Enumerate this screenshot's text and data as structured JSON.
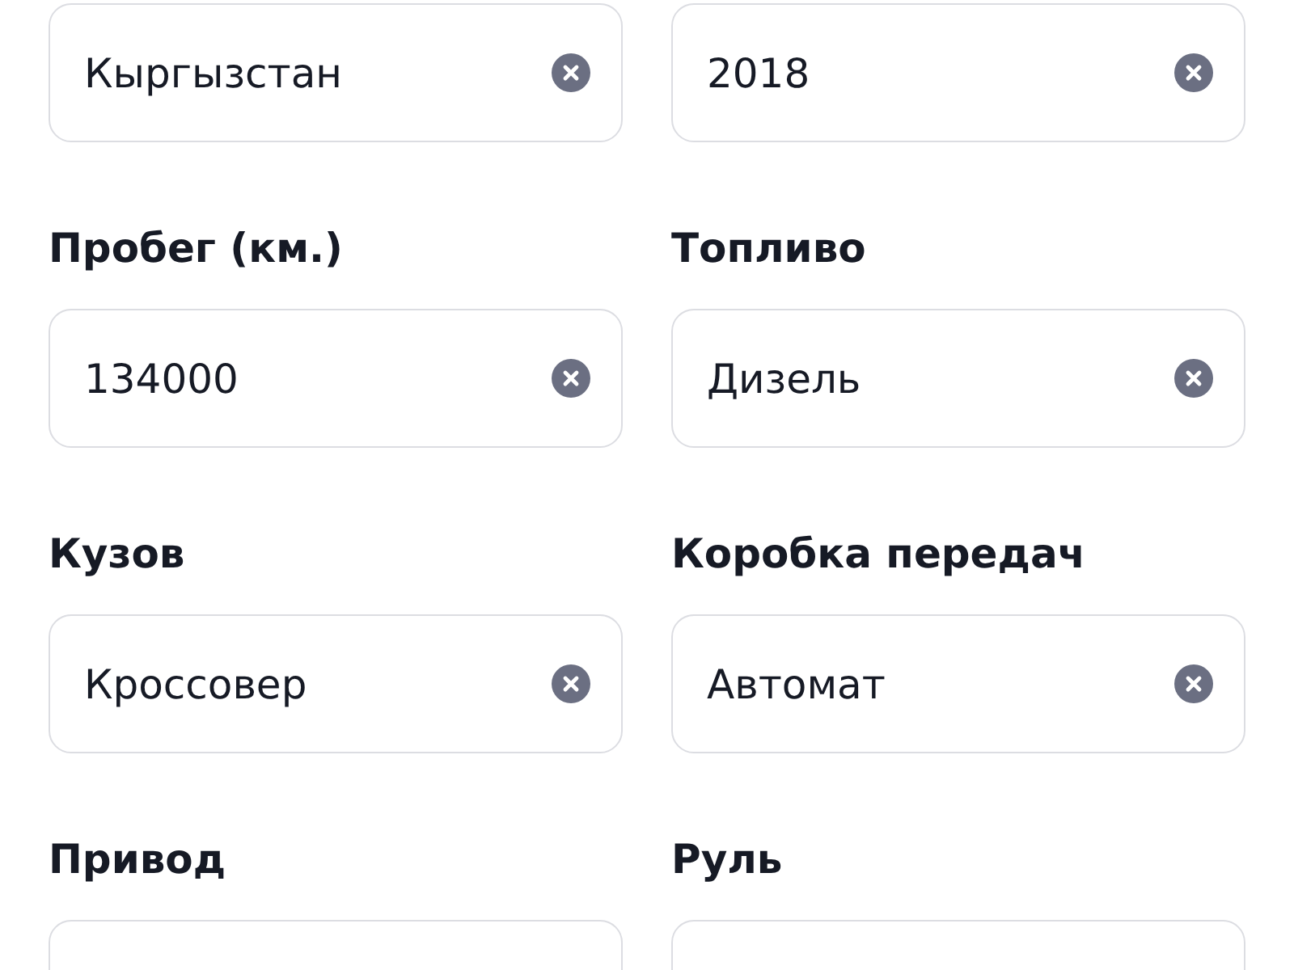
{
  "fields": [
    {
      "value": "Кыргызстан",
      "clearable": true
    },
    {
      "value": "2018",
      "clearable": true
    },
    {
      "label": "Пробег (км.)",
      "value": "134000",
      "clearable": true
    },
    {
      "label": "Топливо",
      "value": "Дизель",
      "clearable": true
    },
    {
      "label": "Кузов",
      "value": "Кроссовер",
      "clearable": true
    },
    {
      "label": "Коробка передач",
      "value": "Автомат",
      "clearable": true
    },
    {
      "label": "Привод"
    },
    {
      "label": "Руль"
    }
  ]
}
